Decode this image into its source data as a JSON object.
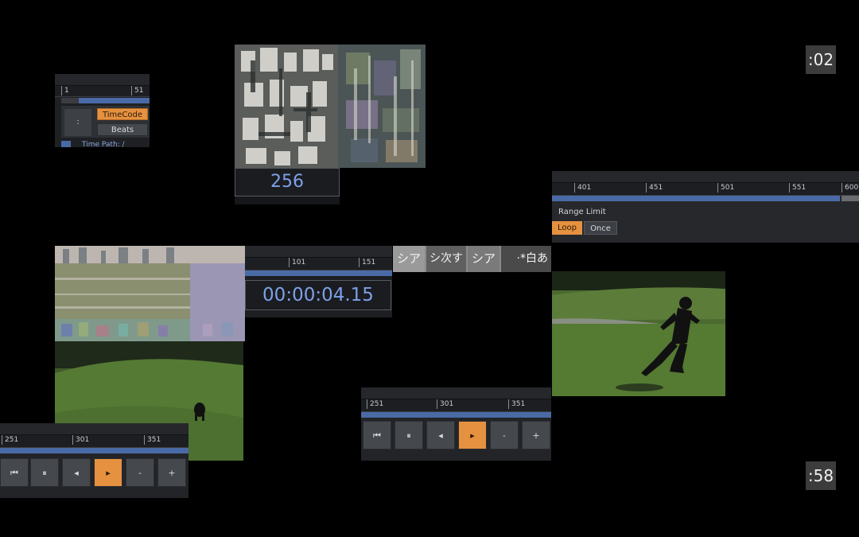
{
  "corner_counters": {
    "top": ":02",
    "bottom": ":58"
  },
  "top_left_panel": {
    "ruler_ticks": [
      "1",
      "51"
    ],
    "mode_active": "TimeCode",
    "mode_inactive": "Beats",
    "small_button": ":",
    "footer_text": "Time Path: /"
  },
  "top_center": {
    "value_display": "256"
  },
  "top_right_panel": {
    "ruler_ticks": [
      "401",
      "451",
      "501",
      "551",
      "600"
    ],
    "range_label": "Range Limit",
    "range_active": "Loop",
    "range_inactive": "Once"
  },
  "center_panel": {
    "ruler_ticks": [
      "101",
      "151"
    ],
    "timecode": "00:00:04.15"
  },
  "bottom_left_transport": {
    "ruler_ticks": [
      "251",
      "301",
      "351"
    ],
    "buttons": [
      "⏮",
      "⏸",
      "◂",
      "▸",
      "-",
      "+"
    ],
    "active_index": 3
  },
  "bottom_center_transport": {
    "ruler_ticks": [
      "251",
      "301",
      "351"
    ],
    "buttons": [
      "⏮",
      "⏸",
      "◂",
      "▸",
      "-",
      "+"
    ],
    "active_index": 3
  },
  "strip_glyphs": [
    "シア",
    "シ次す",
    "シア",
    "·*白あ"
  ],
  "colors": {
    "accent_orange": "#e6913f",
    "bar_blue": "#4a6aa6",
    "value_blue": "#7ea0e8"
  }
}
